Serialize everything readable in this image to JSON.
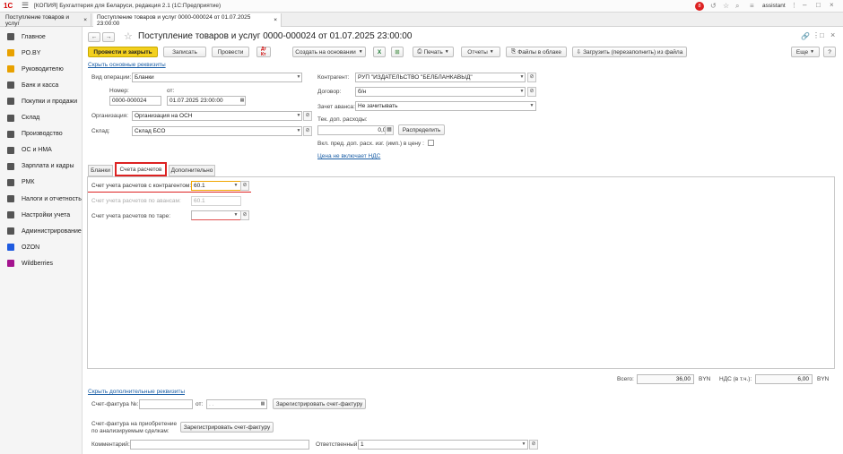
{
  "app": {
    "logo": "1С",
    "title": "[КОПИЯ] Бухгалтерия для Беларуси, редакция 2.1 (1С:Предприятие)",
    "user": "assistant",
    "notification_count": "8"
  },
  "window_tabs": [
    {
      "label": "Поступление товаров и услуг",
      "close": "×"
    },
    {
      "label": "Поступление товаров и услуг 0000-000024 от 01.07.2025 23:00:00",
      "close": "×"
    }
  ],
  "sidebar": {
    "items": [
      {
        "label": "Главное",
        "icon": "menu-lines-icon",
        "color": "#555555"
      },
      {
        "label": "PO.BY",
        "icon": "square-icon",
        "color": "#e8a100"
      },
      {
        "label": "Руководителю",
        "icon": "chart-icon",
        "color": "#e8a100"
      },
      {
        "label": "Банк и касса",
        "icon": "bank-icon",
        "color": "#555555"
      },
      {
        "label": "Покупки и продажи",
        "icon": "cart-icon",
        "color": "#555555"
      },
      {
        "label": "Склад",
        "icon": "warehouse-icon",
        "color": "#555555"
      },
      {
        "label": "Производство",
        "icon": "factory-icon",
        "color": "#555555"
      },
      {
        "label": "ОС и НМА",
        "icon": "car-icon",
        "color": "#555555"
      },
      {
        "label": "Зарплата и кадры",
        "icon": "people-icon",
        "color": "#555555"
      },
      {
        "label": "РМК",
        "icon": "register-icon",
        "color": "#555555"
      },
      {
        "label": "Налоги и отчетность",
        "icon": "tax-icon",
        "color": "#555555"
      },
      {
        "label": "Настройки учета",
        "icon": "book-icon",
        "color": "#555555"
      },
      {
        "label": "Администрирование",
        "icon": "gear-icon",
        "color": "#555555"
      },
      {
        "label": "OZON",
        "icon": "ozon-icon",
        "color": "#1f5be0"
      },
      {
        "label": "Wildberries",
        "icon": "wb-icon",
        "color": "#a4148f"
      }
    ]
  },
  "doc": {
    "title": "Поступление товаров и услуг 0000-000024 от 01.07.2025 23:00:00",
    "buttons": {
      "post_close": "Провести и закрыть",
      "save": "Записать",
      "post": "Провести",
      "based_on": "Создать на основании",
      "print": "Печать",
      "reports": "Отчеты",
      "files": "Файлы в облаке",
      "load": "Загрузить (перезаполнить) из файла",
      "more": "Еще",
      "help": "?"
    },
    "hide_main": "Скрыть основные реквизиты",
    "op_label": "Вид операции:",
    "op_value": "Бланки",
    "num_label": "Номер:",
    "num_value": "0000-000024",
    "from_label": "от:",
    "date_value": "01.07.2025 23:00:00",
    "org_label": "Организация:",
    "org_value": "Организация на ОСН",
    "wh_label": "Склад:",
    "wh_value": "Склад БСО",
    "cp_label": "Контрагент:",
    "cp_value": "РУП \"ИЗДАТЕЛЬСТВО \"БЕЛБЛАНКАВЫД\"",
    "contract_label": "Договор:",
    "contract_value": "б/н",
    "advance_label": "Зачет аванса:",
    "advance_value": "Не зачитывать",
    "extra_label": "Тек. доп. расходы:",
    "extra_value": "0,00",
    "distribute": "Распределить",
    "include_label": "Вкл. пред. доп. расх. изг. (имп.) в цену :",
    "vat_link": "Цена не включает НДС"
  },
  "tabs": [
    "Бланки",
    "Счета расчетов",
    "Дополнительно"
  ],
  "accounts": {
    "contractor_label": "Счет учета расчетов с контрагентом:",
    "contractor_value": "60.1",
    "advance_label": "Счет учета расчетов по авансам:",
    "advance_value": "60.1",
    "tare_label": "Счет учета расчетов по таре:",
    "tare_value": ""
  },
  "totals": {
    "total_label": "Всего:",
    "total_value": "36,00",
    "currency": "BYN",
    "vat_label": "НДС (в т.ч.):",
    "vat_value": "6,00",
    "currency2": "BYN"
  },
  "footer": {
    "hide_extra": "Скрыть дополнительные реквизиты",
    "invoice_label": "Счет-фактура №:",
    "invoice_from": "от:",
    "invoice_date_placeholder": ". .",
    "register_invoice": "Зарегистрировать счет-фактуру",
    "acq_label_1": "Счет-фактура на приобретение",
    "acq_label_2": "по анализируемым сделкам:",
    "register_invoice2": "Зарегистрировать счет-фактуру",
    "comment_label": "Комментарий:",
    "comment_value": "",
    "resp_label": "Ответственный:",
    "resp_value": "1"
  }
}
